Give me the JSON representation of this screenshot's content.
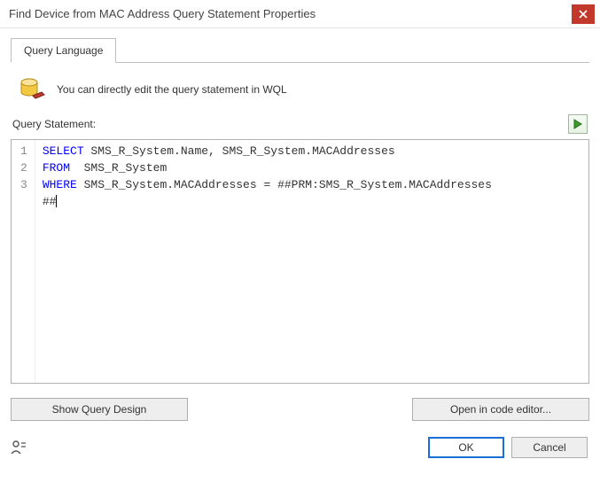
{
  "window": {
    "title": "Find Device from MAC Address Query Statement Properties"
  },
  "tabs": {
    "active": "Query Language"
  },
  "info": {
    "text": "You can directly edit the query statement in WQL"
  },
  "statement": {
    "label": "Query Statement:"
  },
  "code": {
    "line1_kw": "SELECT",
    "line1_rest": " SMS_R_System.Name, SMS_R_System.MACAddresses",
    "line2_kw": "FROM",
    "line2_rest": "  SMS_R_System",
    "line3_kw": "WHERE",
    "line3_rest": " SMS_R_System.MACAddresses = ##PRM:SMS_R_System.MACAddresses",
    "line4": "##"
  },
  "gutter": {
    "l1": "1",
    "l2": "2",
    "l3": "3"
  },
  "buttons": {
    "show_design": "Show Query Design",
    "open_editor": "Open in code editor...",
    "ok": "OK",
    "cancel": "Cancel"
  },
  "icons": {
    "close": "close-icon",
    "database": "database-edit-icon",
    "run": "play-icon",
    "user": "user-interaction-icon"
  }
}
